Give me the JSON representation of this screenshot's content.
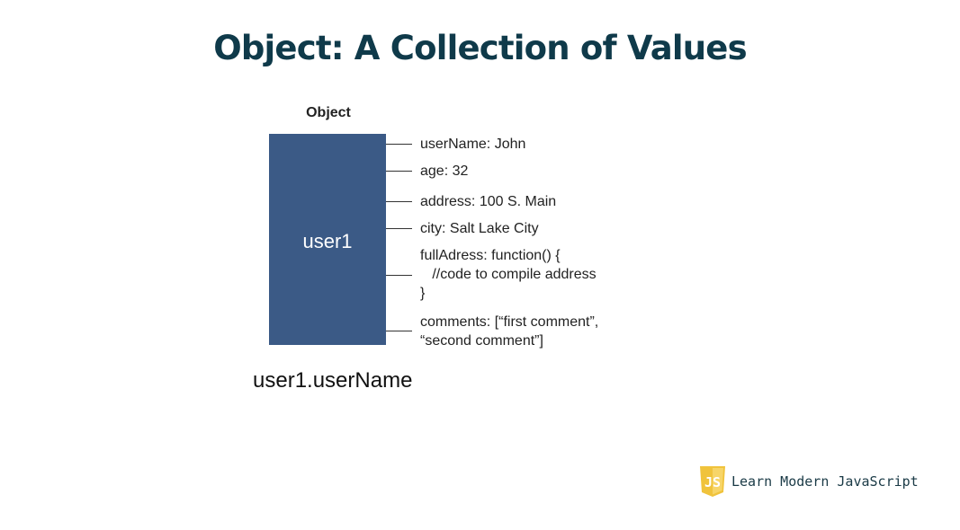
{
  "slide": {
    "title": "Object: A Collection of Values"
  },
  "diagram": {
    "heading": "Object",
    "object_name": "user1",
    "box_color": "#3b5a86",
    "properties": [
      {
        "text": "userName: John"
      },
      {
        "text": "age: 32"
      },
      {
        "text": "address: 100 S. Main"
      },
      {
        "text": "city: Salt Lake City"
      },
      {
        "text": "fullAdress: function() {\n   //code to compile address\n}"
      },
      {
        "text": "comments: [“first comment”,\n“second comment”]"
      }
    ]
  },
  "example": {
    "expression": "user1.userName"
  },
  "branding": {
    "logo_text": "JS",
    "logo_color": "#f0c33c",
    "label": "Learn Modern JavaScript",
    "icon": "js-shield-icon"
  }
}
